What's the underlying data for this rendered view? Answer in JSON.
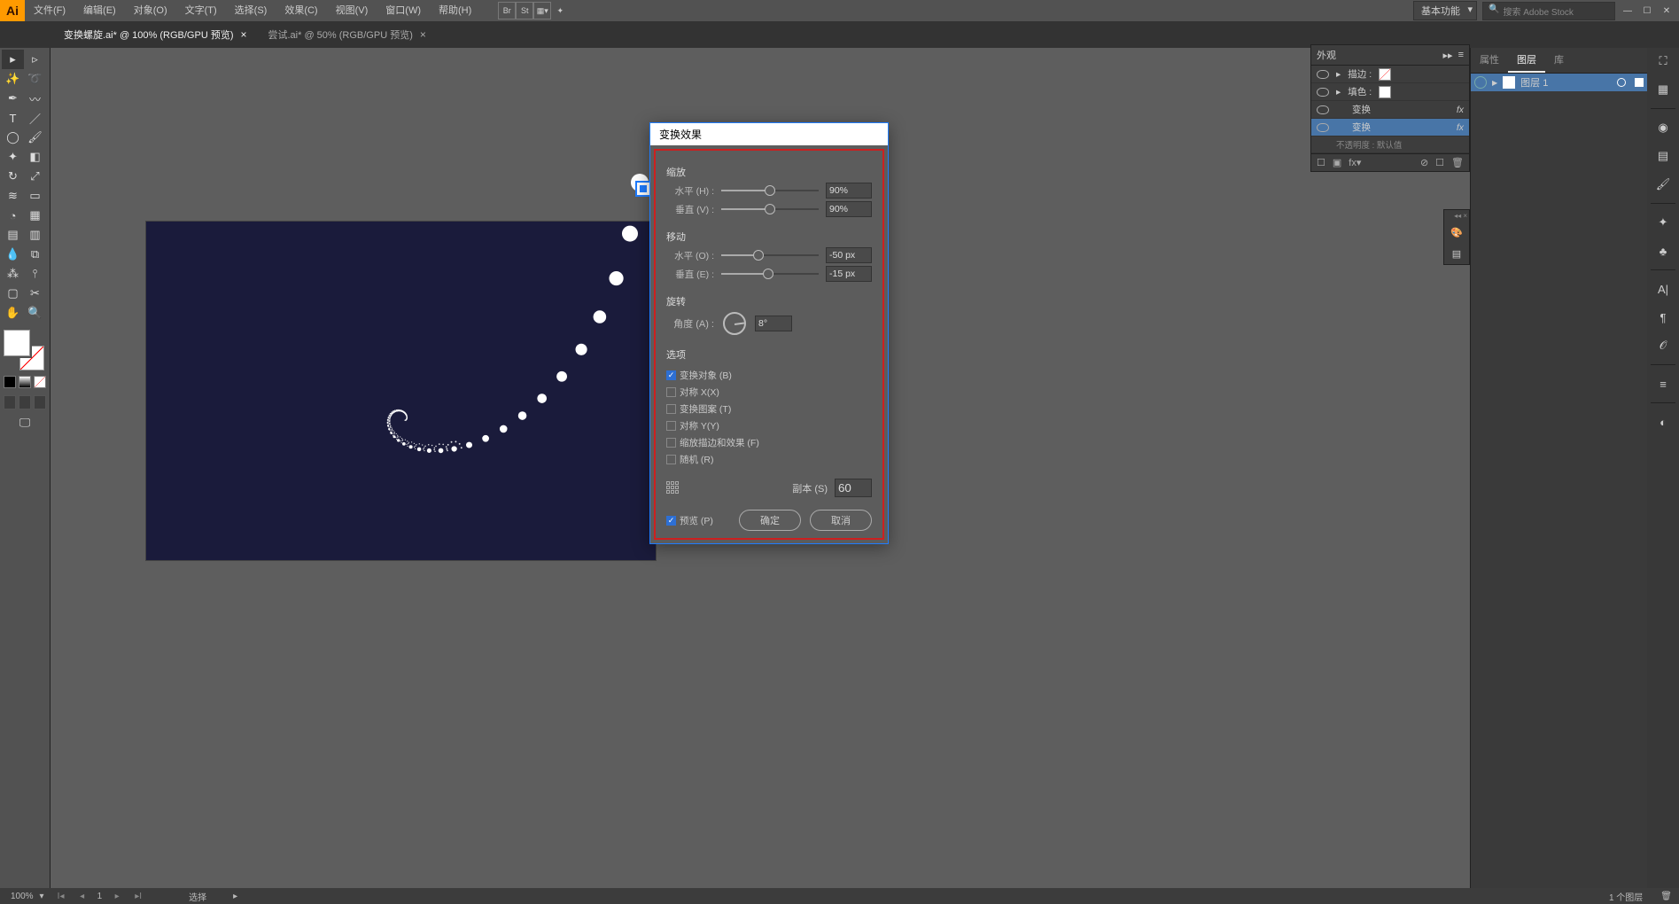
{
  "app": {
    "name": "Ai"
  },
  "menu": [
    "文件(F)",
    "编辑(E)",
    "对象(O)",
    "文字(T)",
    "选择(S)",
    "效果(C)",
    "视图(V)",
    "窗口(W)",
    "帮助(H)"
  ],
  "menubar_right": {
    "workspace": "基本功能",
    "search_placeholder": "搜索 Adobe Stock"
  },
  "tabs": [
    {
      "title": "变换螺旋.ai* @ 100% (RGB/GPU 预览)",
      "active": true
    },
    {
      "title": "尝试.ai* @ 50% (RGB/GPU 预览)",
      "active": false
    }
  ],
  "dialog": {
    "title": "变换效果",
    "sections": {
      "scale": {
        "title": "缩放",
        "h_label": "水平 (H) :",
        "h_val": "90%",
        "v_label": "垂直 (V) :",
        "v_val": "90%"
      },
      "move": {
        "title": "移动",
        "h_label": "水平 (O) :",
        "h_val": "-50 px",
        "v_label": "垂直 (E) :",
        "v_val": "-15 px"
      },
      "rotate": {
        "title": "旋转",
        "a_label": "角度 (A) :",
        "a_val": "8°"
      },
      "options": {
        "title": "选项",
        "opt1": "变换对象 (B)",
        "opt1_c": true,
        "opt2": "对称 X(X)",
        "opt2_c": false,
        "opt3": "变换图案 (T)",
        "opt3_c": false,
        "opt4": "对称 Y(Y)",
        "opt4_c": false,
        "opt5": "缩放描边和效果 (F)",
        "opt5_c": false,
        "opt6": "随机 (R)",
        "opt6_c": false
      },
      "copies_label": "副本 (S)",
      "copies_val": "60"
    },
    "preview_label": "预览 (P)",
    "preview_c": true,
    "ok": "确定",
    "cancel": "取消"
  },
  "appearance": {
    "title": "外观",
    "rows": [
      {
        "label": "描边 :",
        "sw": "none"
      },
      {
        "label": "填色 :",
        "sw": "white"
      },
      {
        "label": "变换",
        "fx": true
      },
      {
        "label": "变换",
        "fx": true,
        "sel": true
      }
    ],
    "foot_label": "不透明度 : 默认值"
  },
  "right_panel": {
    "tabs": [
      "属性",
      "图层",
      "库"
    ],
    "active_tab": 1,
    "layer_name": "图层 1"
  },
  "status": {
    "zoom": "100%",
    "page": "1",
    "tool": "选择",
    "right": "1 个图层"
  }
}
